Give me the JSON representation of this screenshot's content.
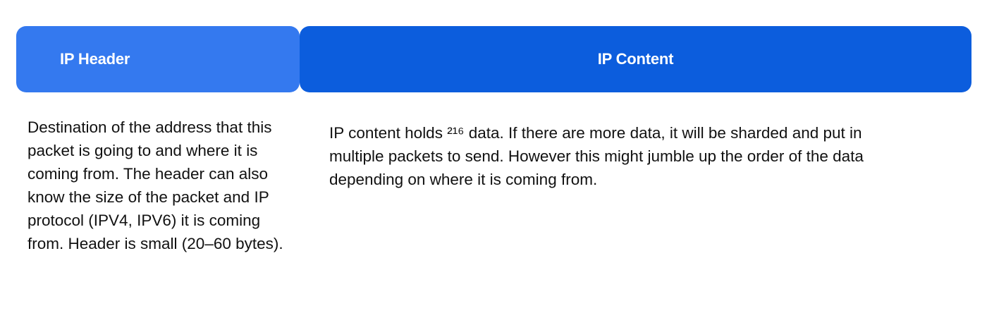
{
  "columns": {
    "header": {
      "title": "IP Header",
      "description": "Destination of the address that this packet is going to and where it is coming from. The header can also know the size of the packet and IP protocol (IPV4, IPV6) it is coming from. Header is small (20–60 bytes)."
    },
    "content": {
      "title": "IP Content",
      "description": "IP content holds ²¹⁶ data. If there are more data, it will be sharded and put in multiple packets to send. However this might jumble up the order of the data depending on where it is coming from."
    }
  },
  "colors": {
    "header_bg": "#3479ef",
    "content_bg": "#0c5ddd",
    "heading_text": "#ffffff",
    "body_text": "#111111"
  }
}
